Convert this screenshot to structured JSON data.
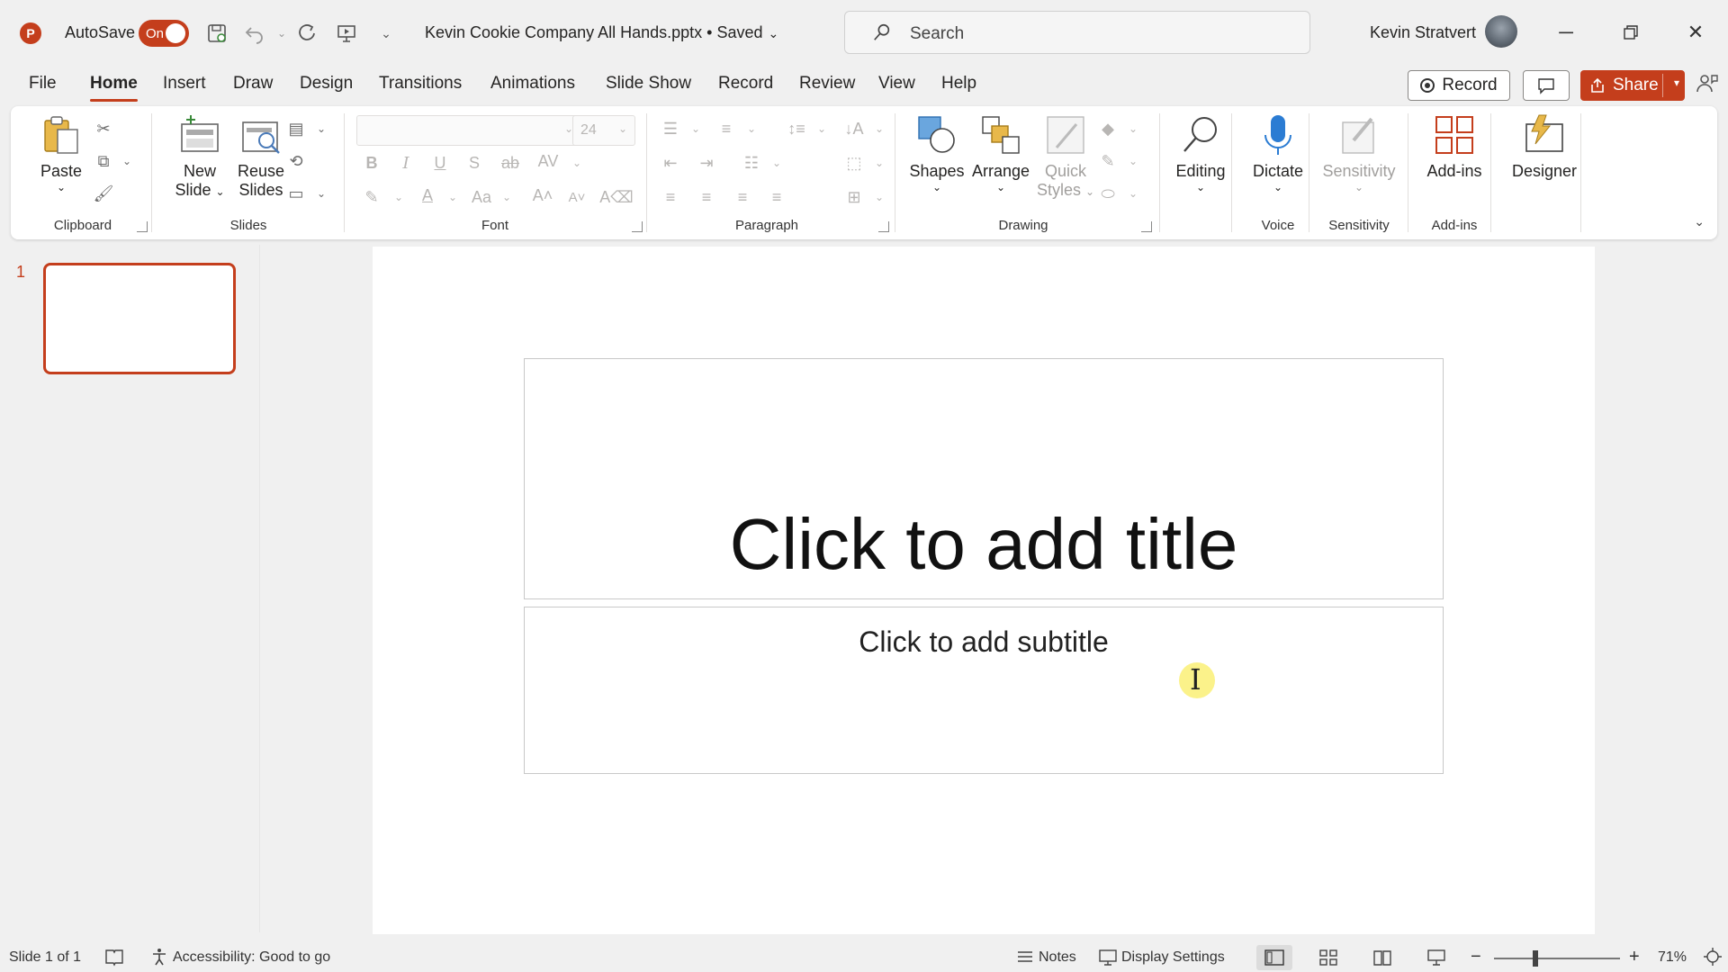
{
  "titlebar": {
    "app_logo": "P",
    "autosave_label": "AutoSave",
    "autosave_state": "On",
    "document_title": "Kevin Cookie Company All Hands.pptx • Saved",
    "search_placeholder": "Search",
    "user_name": "Kevin Stratvert"
  },
  "tabs": [
    "File",
    "Home",
    "Insert",
    "Draw",
    "Design",
    "Transitions",
    "Animations",
    "Slide Show",
    "Record",
    "Review",
    "View",
    "Help"
  ],
  "actions": {
    "record_label": "Record",
    "share_label": "Share"
  },
  "ribbon": {
    "clipboard": {
      "paste": "Paste",
      "group": "Clipboard"
    },
    "slides": {
      "new_slide_1": "New",
      "new_slide_2": "Slide",
      "reuse_1": "Reuse",
      "reuse_2": "Slides",
      "group": "Slides"
    },
    "font": {
      "size": "24",
      "group": "Font"
    },
    "paragraph": {
      "group": "Paragraph"
    },
    "drawing": {
      "shapes": "Shapes",
      "arrange": "Arrange",
      "quick_1": "Quick",
      "quick_2": "Styles",
      "group": "Drawing"
    },
    "editing": {
      "label": "Editing"
    },
    "voice": {
      "dictate": "Dictate",
      "group": "Voice"
    },
    "sensitivity": {
      "label": "Sensitivity",
      "group": "Sensitivity"
    },
    "addins": {
      "label": "Add-ins",
      "group": "Add-ins"
    },
    "designer": {
      "label": "Designer"
    }
  },
  "thumbnails": {
    "slide_number": "1"
  },
  "slide": {
    "title_placeholder": "Click to add title",
    "subtitle_placeholder": "Click to add subtitle"
  },
  "statusbar": {
    "slide_info": "Slide 1 of 1",
    "accessibility": "Accessibility: Good to go",
    "notes": "Notes",
    "display_settings": "Display Settings",
    "zoom_minus": "−",
    "zoom_plus": "+",
    "zoom_level": "71%"
  },
  "colors": {
    "accent": "#c43e1c",
    "highlight_cursor": "#fbf28a"
  }
}
